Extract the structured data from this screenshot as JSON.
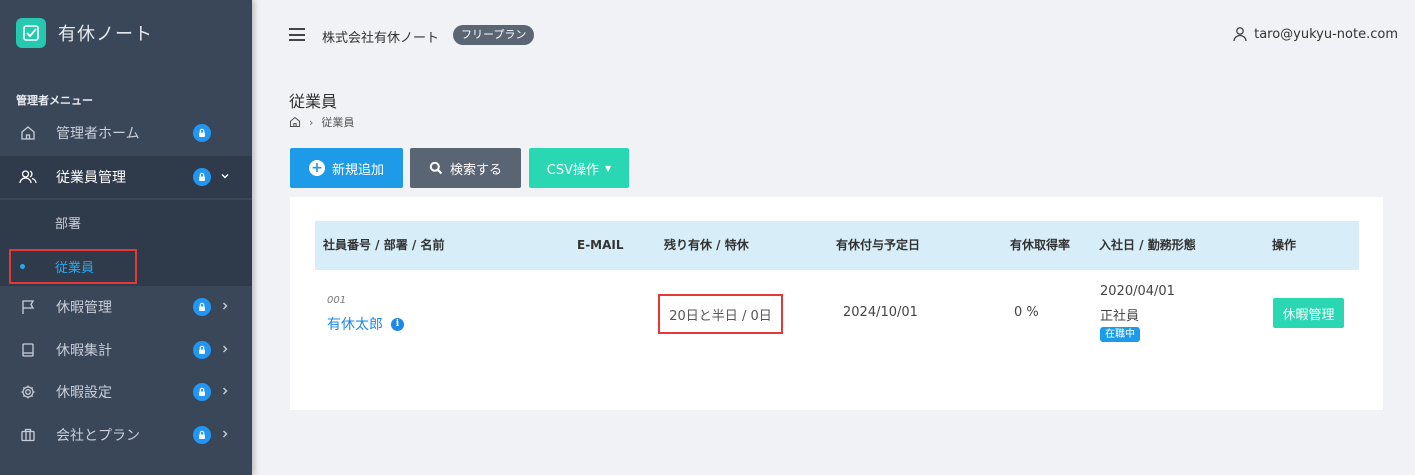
{
  "app": {
    "name": "有休ノート"
  },
  "sidebar": {
    "menu_header": "管理者メニュー",
    "items": [
      {
        "label": "管理者ホーム",
        "icon": "home-icon"
      },
      {
        "label": "従業員管理",
        "icon": "users-icon"
      },
      {
        "label": "休暇管理",
        "icon": "flag-icon"
      },
      {
        "label": "休暇集計",
        "icon": "book-icon"
      },
      {
        "label": "休暇設定",
        "icon": "gear-icon"
      },
      {
        "label": "会社とプラン",
        "icon": "briefcase-icon"
      }
    ],
    "subitems": [
      {
        "label": "部署"
      },
      {
        "label": "従業員"
      }
    ]
  },
  "header": {
    "company": "株式会社有休ノート",
    "plan": "フリープラン",
    "user_email": "taro@yukyu-note.com"
  },
  "page": {
    "title": "従業員",
    "breadcrumb_current": "従業員"
  },
  "toolbar": {
    "add_label": "新規追加",
    "search_label": "検索する",
    "csv_label": "CSV操作"
  },
  "table": {
    "headers": [
      "社員番号 / 部署 / 名前",
      "E-MAIL",
      "残り有休 / 特休",
      "有休付与予定日",
      "有休取得率",
      "入社日 / 勤務形態",
      "操作"
    ],
    "rows": [
      {
        "emp_no": "001",
        "name": "有休太郎",
        "email": "",
        "remaining": "20日と半日 / 0日",
        "grant_date": "2024/10/01",
        "rate": "0 %",
        "join_date": "2020/04/01",
        "employment_type": "正社員",
        "status": "在職中",
        "action": "休暇管理"
      }
    ]
  },
  "colors": {
    "sidebar_bg": "#3a4759",
    "accent_blue": "#1e9be8",
    "accent_teal": "#29d8b2",
    "highlight_red": "#e53935",
    "table_header_bg": "#d7eef9"
  }
}
